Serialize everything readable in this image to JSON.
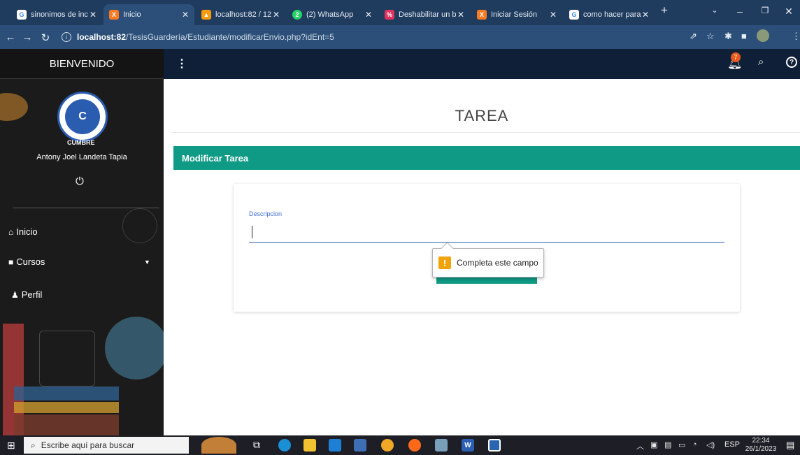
{
  "browser": {
    "tabs": [
      {
        "title": "sinonimos de inc",
        "icon": "google-icon",
        "active": false
      },
      {
        "title": "Inicio",
        "icon": "xampp-icon",
        "active": true
      },
      {
        "title": "localhost:82 / 12",
        "icon": "phpmyadmin-icon",
        "active": false
      },
      {
        "title": "(2) WhatsApp",
        "icon": "whatsapp-icon",
        "active": false
      },
      {
        "title": "Deshabilitar un b",
        "icon": "site-icon",
        "active": false
      },
      {
        "title": "Iniciar Sesión",
        "icon": "xampp-icon",
        "active": false
      },
      {
        "title": "como hacer para",
        "icon": "google-icon",
        "active": false
      }
    ],
    "new_tab": "+",
    "url_host": "localhost:82",
    "url_path": "/TesisGuardería/Estudiante/modificarEnvio.php?idEnt=5"
  },
  "header": {
    "menu_icon": "⋮",
    "notification_count": "7"
  },
  "sidebar": {
    "title": "BIENVENIDO",
    "logo_text": "CUMBRE",
    "user_name": "Antony Joel Landeta Tapia",
    "items": [
      {
        "label": "Inicio",
        "icon": "home-icon"
      },
      {
        "label": "Cursos",
        "icon": "book-icon"
      },
      {
        "label": "Perfil",
        "icon": "user-icon"
      }
    ]
  },
  "main": {
    "page_title": "TAREA",
    "section_title": "Modificar Tarea",
    "form": {
      "description_label": "Descripcion",
      "description_value": ""
    },
    "validation_tooltip": "Completa este campo"
  },
  "taskbar": {
    "search_placeholder": "Escribe aquí para buscar",
    "language": "ESP",
    "time": "22:34",
    "date": "26/1/2023"
  },
  "colors": {
    "accent": "#0e9a84",
    "header": "#0f1f37",
    "sidebar": "#1b1b1b",
    "browser_frame": "#1f3b5e"
  }
}
